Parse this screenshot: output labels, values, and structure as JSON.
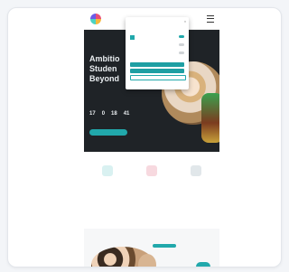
{
  "colors": {
    "accent": "#21a8ab",
    "hero_bg": "#1f2327"
  },
  "header": {
    "logo_text": "",
    "menu_icon": "hamburger-icon"
  },
  "hero": {
    "eyebrow": "",
    "lines": [
      "Ambitio",
      "Studen",
      "Beyond"
    ],
    "subtext": [
      "",
      "",
      ""
    ],
    "countdown": [
      {
        "value": "17",
        "label": ""
      },
      {
        "value": "0",
        "label": ""
      },
      {
        "value": "18",
        "label": ""
      },
      {
        "value": "41",
        "label": ""
      }
    ],
    "cta": ""
  },
  "services": [
    {
      "icon": "globe-icon",
      "title": "",
      "text": "",
      "link": ""
    },
    {
      "icon": "lightbulb-icon",
      "title": "",
      "text": "",
      "link": ""
    },
    {
      "icon": "image-icon",
      "title": "",
      "text": "",
      "link": ""
    }
  ],
  "modal": {
    "title": "",
    "close_icon": "close-icon",
    "rows": [
      "",
      "",
      ""
    ],
    "buttons": [
      "",
      "",
      ""
    ],
    "footer": ""
  },
  "widgets": {
    "chat_icon": "chat-icon",
    "close_icon": "close-icon"
  }
}
